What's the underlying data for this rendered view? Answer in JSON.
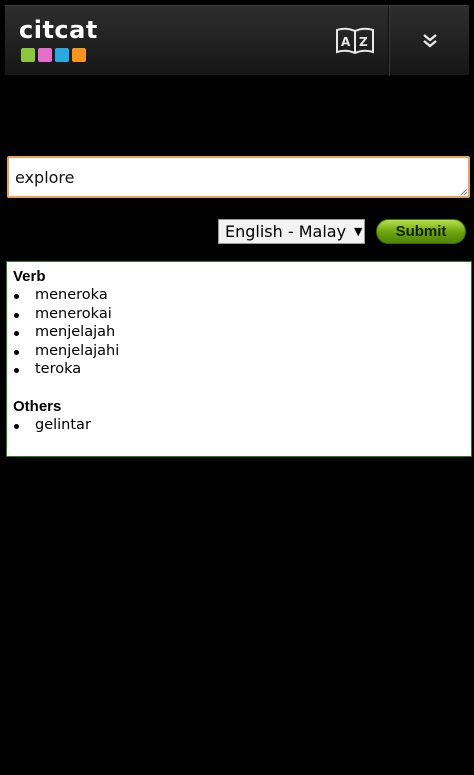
{
  "header": {
    "logo_text": "citcat",
    "logo_colors": [
      "#8dc63f",
      "#e36fcb",
      "#27aae1",
      "#f7941d"
    ],
    "dictionary_icon": "az-book-icon",
    "menu_icon": "double-chevron-down-icon"
  },
  "search": {
    "value": "explore",
    "placeholder": ""
  },
  "language": {
    "selected": "English - Malay"
  },
  "submit_label": "Submit",
  "results": {
    "groups": [
      {
        "title": "Verb",
        "items": [
          "meneroka",
          "menerokai",
          "menjelajah",
          "menjelajahi",
          "teroka"
        ]
      },
      {
        "title": "Others",
        "items": [
          "gelintar"
        ]
      }
    ]
  },
  "colors": {
    "input_border": "#e8a25a",
    "submit_green": "#6ba20e",
    "results_border": "#2c7a1e"
  }
}
